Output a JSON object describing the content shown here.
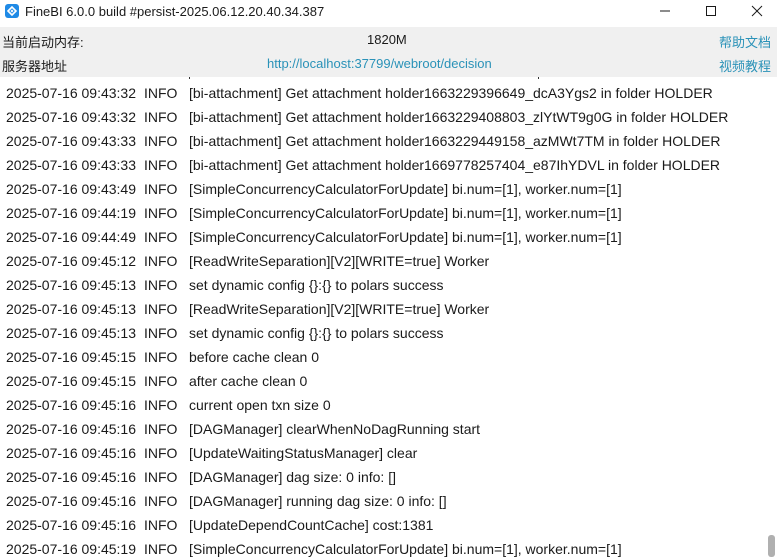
{
  "window": {
    "title": "FineBI 6.0.0 build #persist-2025.06.12.20.40.34.387",
    "icon": "finebi-app-icon",
    "controls": [
      "minimize-icon",
      "maximize-icon",
      "close-icon"
    ]
  },
  "info": {
    "memory_label": "当前启动内存:",
    "memory_value": "1820M",
    "server_label": "服务器地址",
    "server_url": "http://localhost:37799/webroot/decision",
    "help_link": "帮助文档",
    "video_link": "视频教程"
  },
  "colors": {
    "link": "#2a92b8",
    "panel_bg": "#f0f0f0",
    "log_bg": "#ffffff"
  },
  "logs": [
    {
      "time": "2025-07-16 09:43:32",
      "level": "INFO",
      "message": "[bi-attachment] Get attachment holder1663229396649_dcA3Ygs2 in folder HOLDER"
    },
    {
      "time": "2025-07-16 09:43:32",
      "level": "INFO",
      "message": "[bi-attachment] Get attachment holder1663229408803_zlYtWT9g0G in folder HOLDER"
    },
    {
      "time": "2025-07-16 09:43:33",
      "level": "INFO",
      "message": "[bi-attachment] Get attachment holder1663229449158_azMWt7TM in folder HOLDER"
    },
    {
      "time": "2025-07-16 09:43:33",
      "level": "INFO",
      "message": "[bi-attachment] Get attachment holder1669778257404_e87IhYDVL in folder HOLDER"
    },
    {
      "time": "2025-07-16 09:43:49",
      "level": "INFO",
      "message": "[SimpleConcurrencyCalculatorForUpdate] bi.num=[1], worker.num=[1]"
    },
    {
      "time": "2025-07-16 09:44:19",
      "level": "INFO",
      "message": "[SimpleConcurrencyCalculatorForUpdate] bi.num=[1], worker.num=[1]"
    },
    {
      "time": "2025-07-16 09:44:49",
      "level": "INFO",
      "message": "[SimpleConcurrencyCalculatorForUpdate] bi.num=[1], worker.num=[1]"
    },
    {
      "time": "2025-07-16 09:45:12",
      "level": "INFO",
      "message": "[ReadWriteSeparation][V2][WRITE=true] Worker"
    },
    {
      "time": "2025-07-16 09:45:13",
      "level": "INFO",
      "message": "set dynamic config {}:{} to polars success"
    },
    {
      "time": "2025-07-16 09:45:13",
      "level": "INFO",
      "message": "[ReadWriteSeparation][V2][WRITE=true] Worker"
    },
    {
      "time": "2025-07-16 09:45:13",
      "level": "INFO",
      "message": "set dynamic config {}:{} to polars success"
    },
    {
      "time": "2025-07-16 09:45:15",
      "level": "INFO",
      "message": "before cache clean 0"
    },
    {
      "time": "2025-07-16 09:45:15",
      "level": "INFO",
      "message": "after cache clean 0"
    },
    {
      "time": "2025-07-16 09:45:16",
      "level": "INFO",
      "message": "current open txn size 0"
    },
    {
      "time": "2025-07-16 09:45:16",
      "level": "INFO",
      "message": "[DAGManager] clearWhenNoDagRunning start"
    },
    {
      "time": "2025-07-16 09:45:16",
      "level": "INFO",
      "message": "[UpdateWaitingStatusManager] clear"
    },
    {
      "time": "2025-07-16 09:45:16",
      "level": "INFO",
      "message": "[DAGManager] dag size: 0 info: []"
    },
    {
      "time": "2025-07-16 09:45:16",
      "level": "INFO",
      "message": "[DAGManager] running dag size: 0 info: []"
    },
    {
      "time": "2025-07-16 09:45:16",
      "level": "INFO",
      "message": "[UpdateDependCountCache] cost:1381"
    },
    {
      "time": "2025-07-16 09:45:19",
      "level": "INFO",
      "message": "[SimpleConcurrencyCalculatorForUpdate] bi.num=[1], worker.num=[1]"
    }
  ]
}
